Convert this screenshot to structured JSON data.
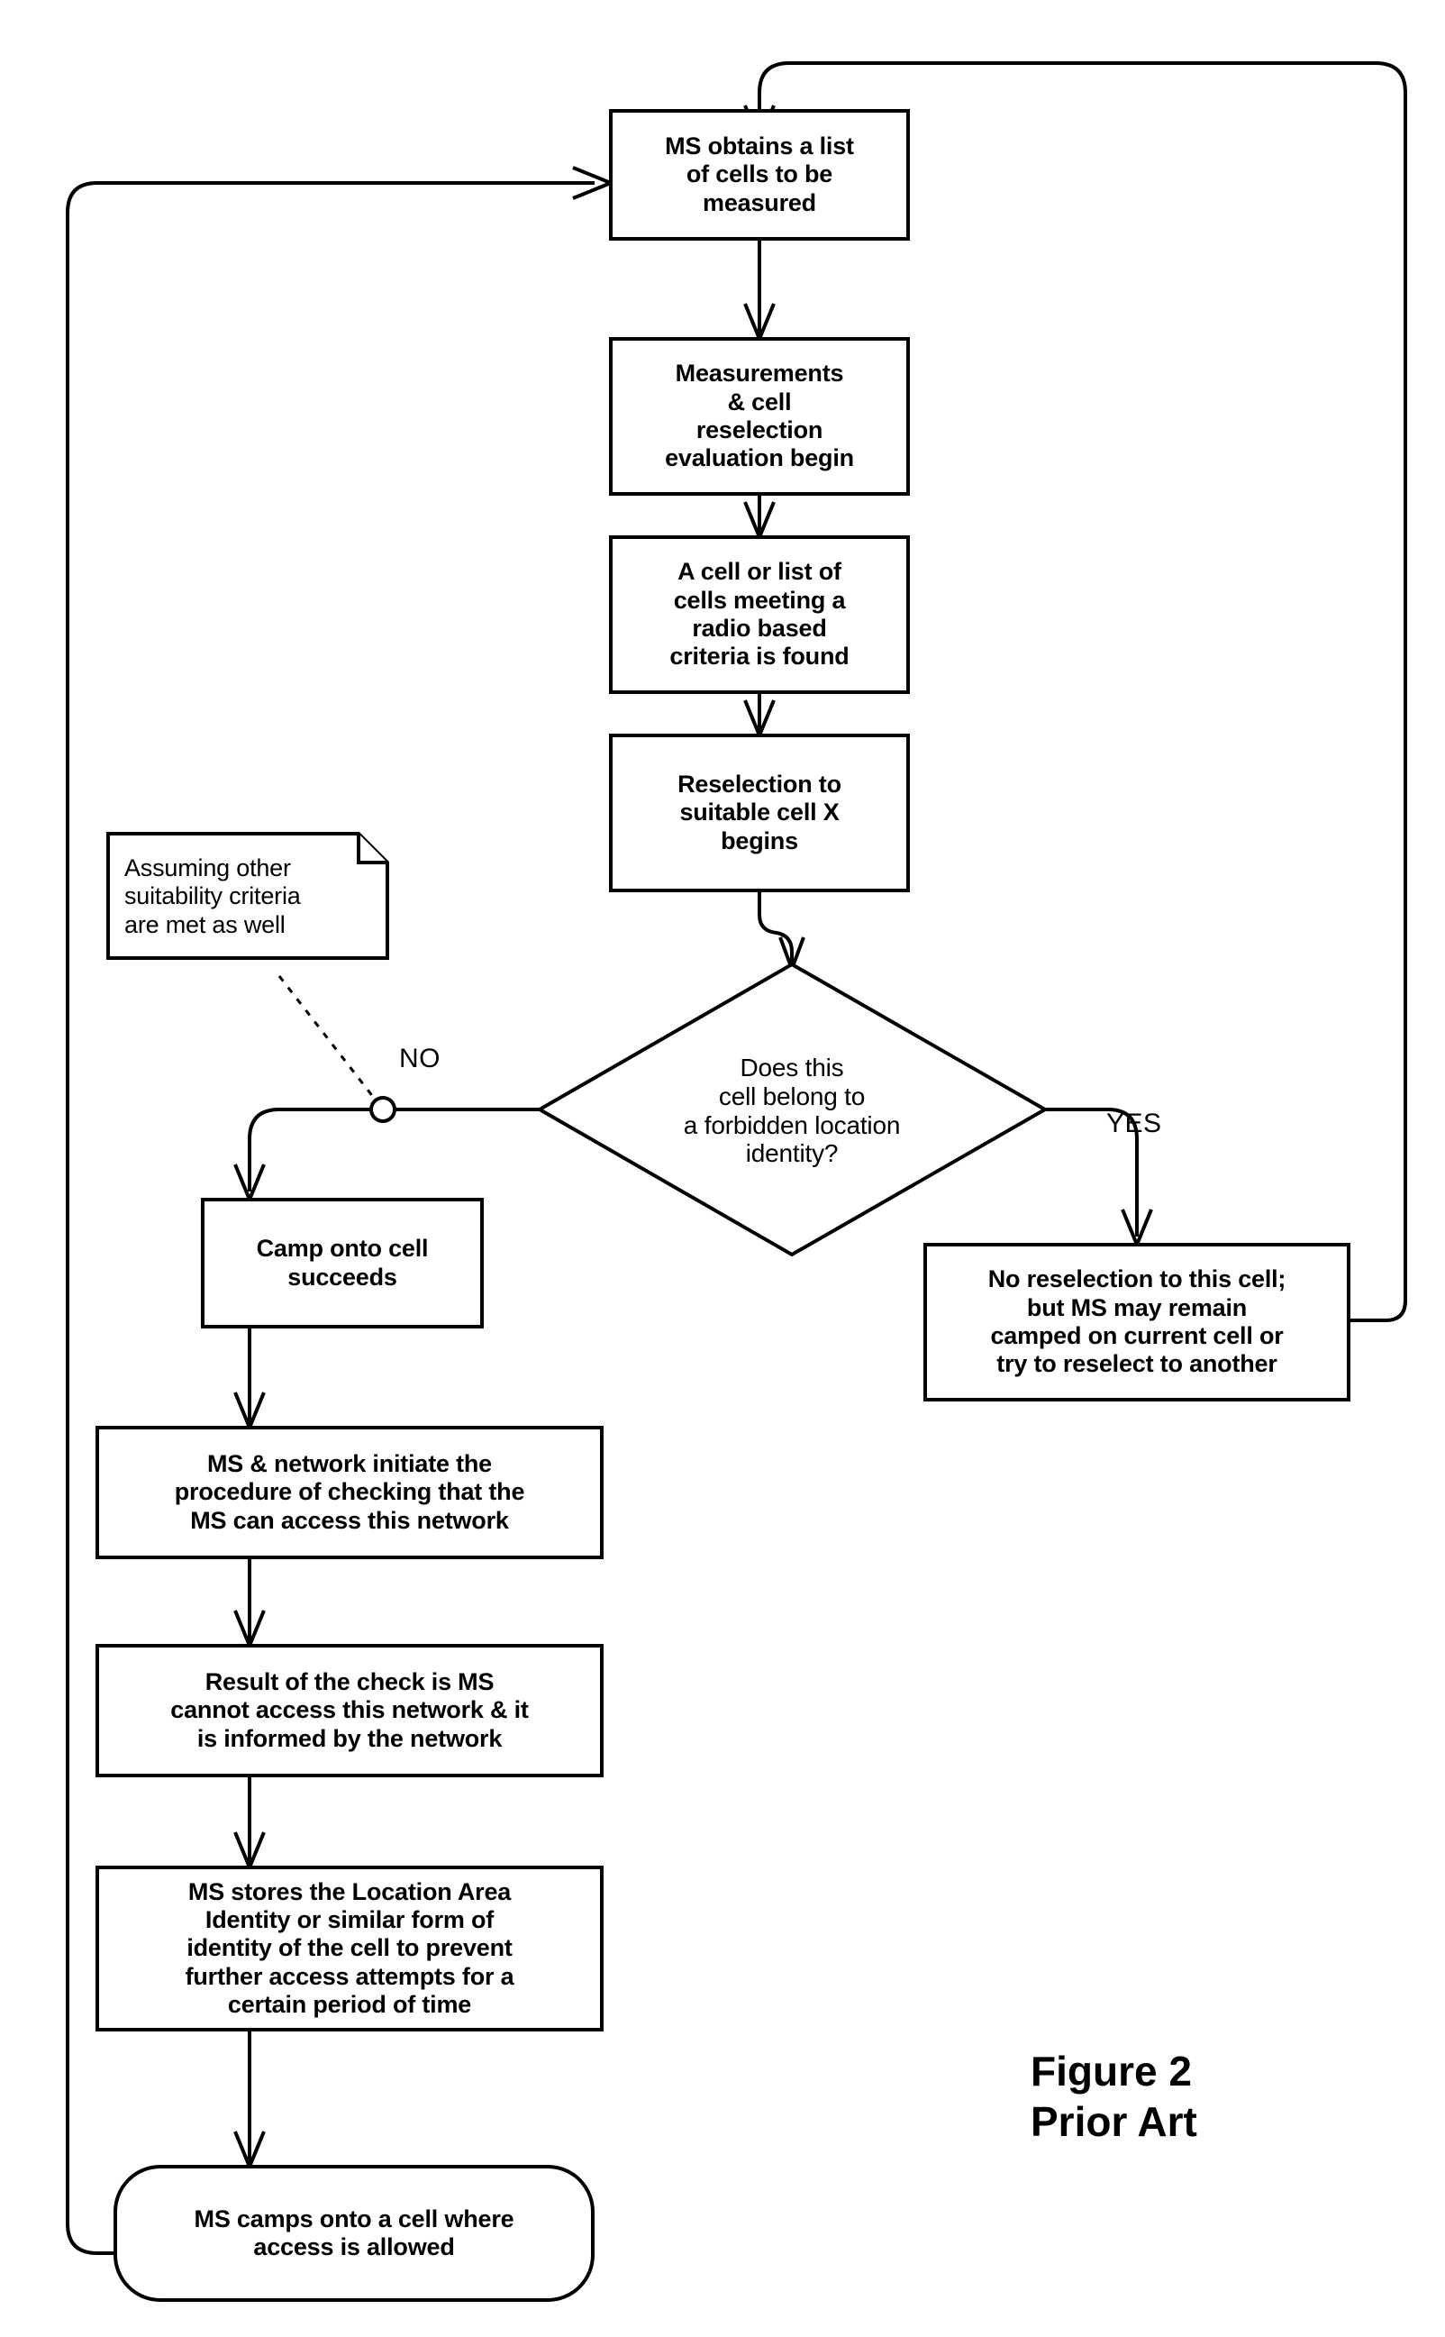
{
  "figure": {
    "caption_line1": "Figure 2",
    "caption_line2": "Prior Art"
  },
  "nodes": {
    "obtain_list": {
      "line1": "MS obtains a list",
      "line2": "of cells to be",
      "line3": "measured"
    },
    "measurements": {
      "line1": "Measurements",
      "line2": "& cell",
      "line3": "reselection",
      "line4": "evaluation begin"
    },
    "criteria_found": {
      "line1": "A cell or list of",
      "line2": "cells meeting a",
      "line3": "radio based",
      "line4": "criteria is found"
    },
    "reselection_begins": {
      "line1": "Reselection to",
      "line2": "suitable cell X",
      "line3": "begins"
    },
    "decision": {
      "line1": "Does this",
      "line2": "cell belong to",
      "line3": "a forbidden location",
      "line4": "identity?"
    },
    "note": {
      "line1": "Assuming other",
      "line2": "suitability criteria",
      "line3": "are met as well"
    },
    "camp_succeeds": {
      "line1": "Camp onto cell",
      "line2": "succeeds"
    },
    "no_reselection": {
      "line1": "No reselection to this cell;",
      "line2": "but MS may remain",
      "line3": "camped on current cell or",
      "line4": "try to reselect to another"
    },
    "initiate_check": {
      "line1": "MS & network initiate the",
      "line2": "procedure of checking that the",
      "line3": "MS can access this network"
    },
    "check_result": {
      "line1": "Result of the check is MS",
      "line2": "cannot access this network & it",
      "line3": "is informed by the network"
    },
    "store_lai": {
      "line1": "MS stores the Location Area",
      "line2": "Identity or similar form of",
      "line3": "identity of the cell to prevent",
      "line4": "further access attempts for a",
      "line5": "certain period of time"
    },
    "camps_allowed": {
      "line1": "MS camps onto a cell where",
      "line2": "access is allowed"
    }
  },
  "branch_labels": {
    "no": "NO",
    "yes": "YES"
  },
  "colors": {
    "stroke": "#000000",
    "fill": "#ffffff",
    "text": "#000000"
  }
}
